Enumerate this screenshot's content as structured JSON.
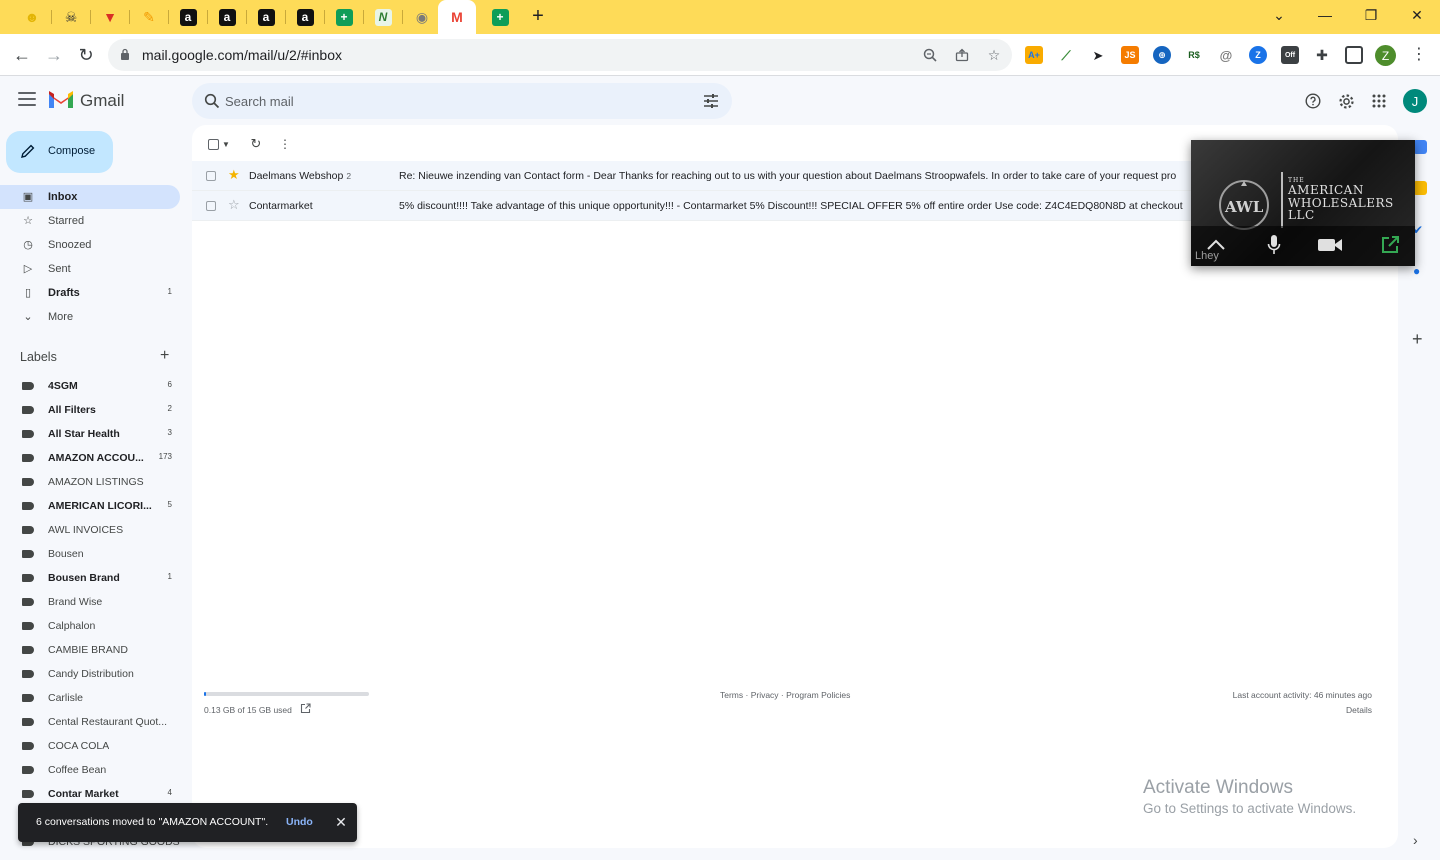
{
  "browser": {
    "tabs": [
      {
        "icon": "lemon-icon",
        "color": "#e3b505",
        "glyph": "☻"
      },
      {
        "icon": "pirate-icon",
        "color": "#333333",
        "glyph": "☠"
      },
      {
        "icon": "red-v-icon",
        "color": "#d93025",
        "glyph": "▼"
      },
      {
        "icon": "pencil-icon",
        "color": "#f29900",
        "glyph": "✎"
      },
      {
        "icon": "amazon-icon",
        "color": "#111111",
        "glyph": "a"
      },
      {
        "icon": "amazon-icon",
        "color": "#111111",
        "glyph": "a"
      },
      {
        "icon": "amazon-icon",
        "color": "#111111",
        "glyph": "a"
      },
      {
        "icon": "amazon-icon",
        "color": "#111111",
        "glyph": "a"
      },
      {
        "icon": "sheets-icon",
        "color": "#0f9d58",
        "glyph": "+"
      },
      {
        "icon": "green-n-icon",
        "color": "#2e7d32",
        "glyph": "N"
      },
      {
        "icon": "globe-icon",
        "color": "#7a7a7a",
        "glyph": "◉"
      },
      {
        "icon": "gmail-icon",
        "color": "#ea4335",
        "glyph": "M",
        "active": true
      },
      {
        "icon": "sheets-icon",
        "color": "#0f9d58",
        "glyph": "+"
      }
    ],
    "url": "mail.google.com/mail/u/2/#inbox",
    "profile_initial": "Z"
  },
  "gmail": {
    "wordmark": "Gmail",
    "search_placeholder": "Search mail",
    "avatar_initial": "J",
    "compose_label": "Compose",
    "nav": [
      {
        "label": "Inbox",
        "icon": "inbox-icon",
        "glyph": "▣",
        "active": true,
        "bold": true,
        "count": ""
      },
      {
        "label": "Starred",
        "icon": "star-icon",
        "glyph": "☆",
        "count": ""
      },
      {
        "label": "Snoozed",
        "icon": "clock-icon",
        "glyph": "◷",
        "count": ""
      },
      {
        "label": "Sent",
        "icon": "send-icon",
        "glyph": "▷",
        "count": ""
      },
      {
        "label": "Drafts",
        "icon": "draft-icon",
        "glyph": "▯",
        "bold": true,
        "count": "1"
      },
      {
        "label": "More",
        "icon": "chevron-down-icon",
        "glyph": "⌄",
        "count": ""
      }
    ],
    "labels_title": "Labels",
    "labels": [
      {
        "label": "4SGM",
        "bold": true,
        "count": "6"
      },
      {
        "label": "All Filters",
        "bold": true,
        "count": "2"
      },
      {
        "label": "All Star Health",
        "bold": true,
        "count": "3"
      },
      {
        "label": "AMAZON ACCOU...",
        "bold": true,
        "count": "173"
      },
      {
        "label": "AMAZON LISTINGS",
        "bold": false,
        "count": ""
      },
      {
        "label": "AMERICAN LICORI...",
        "bold": true,
        "count": "5"
      },
      {
        "label": "AWL INVOICES",
        "bold": false,
        "count": ""
      },
      {
        "label": "Bousen",
        "bold": false,
        "count": ""
      },
      {
        "label": "Bousen Brand",
        "bold": true,
        "count": "1"
      },
      {
        "label": "Brand Wise",
        "bold": false,
        "count": ""
      },
      {
        "label": "Calphalon",
        "bold": false,
        "count": ""
      },
      {
        "label": "CAMBIE BRAND",
        "bold": false,
        "count": ""
      },
      {
        "label": "Candy Distribution",
        "bold": false,
        "count": ""
      },
      {
        "label": "Carlisle",
        "bold": false,
        "count": ""
      },
      {
        "label": "Cental Restaurant Quot...",
        "bold": false,
        "count": ""
      },
      {
        "label": "COCA COLA",
        "bold": false,
        "count": ""
      },
      {
        "label": "Coffee Bean",
        "bold": false,
        "count": ""
      },
      {
        "label": "Contar Market",
        "bold": true,
        "count": "4"
      }
    ],
    "under_snackbar_label": "DICKS SPORTING GOODS",
    "emails": [
      {
        "sender": "Daelmans Webshop",
        "thread_count": "2",
        "starred": true,
        "subject": "Re: Nieuwe inzending van Contact form - Dear Thanks for reaching out to us with your question about Daelmans Stroopwafels. In order to take care of your request pro"
      },
      {
        "sender": "Contarmarket",
        "thread_count": "",
        "starred": false,
        "subject": "5% discount!!!! Take advantage of this unique opportunity!!! - Contarmarket 5% Discount!!! SPECIAL OFFER 5% off entire order Use code: Z4C4EDQ80N8D at checkout"
      }
    ],
    "storage": {
      "text": "0.13 GB of 15 GB used",
      "fraction_used": 0.0087
    },
    "footer_links": "Terms · Privacy · Program Policies",
    "last_activity": "Last account activity: 46 minutes ago",
    "details": "Details"
  },
  "pip": {
    "brand_small": "THE",
    "brand_line1": "AMERICAN",
    "brand_line2": "WHOLESALERS",
    "brand_line3": "LLC",
    "logo_text": "AWL",
    "caption": "Lhey"
  },
  "snackbar": {
    "message": "6 conversations moved to \"AMAZON ACCOUNT\".",
    "undo": "Undo"
  },
  "windows_watermark": {
    "line1": "Activate Windows",
    "line2": "Go to Settings to activate Windows."
  },
  "colors": {
    "tabstrip": "#fedb58",
    "compose": "#c2e7ff",
    "inbox_active": "#d3e3fd",
    "star": "#f4b400",
    "link_blue": "#8ab4f8"
  }
}
